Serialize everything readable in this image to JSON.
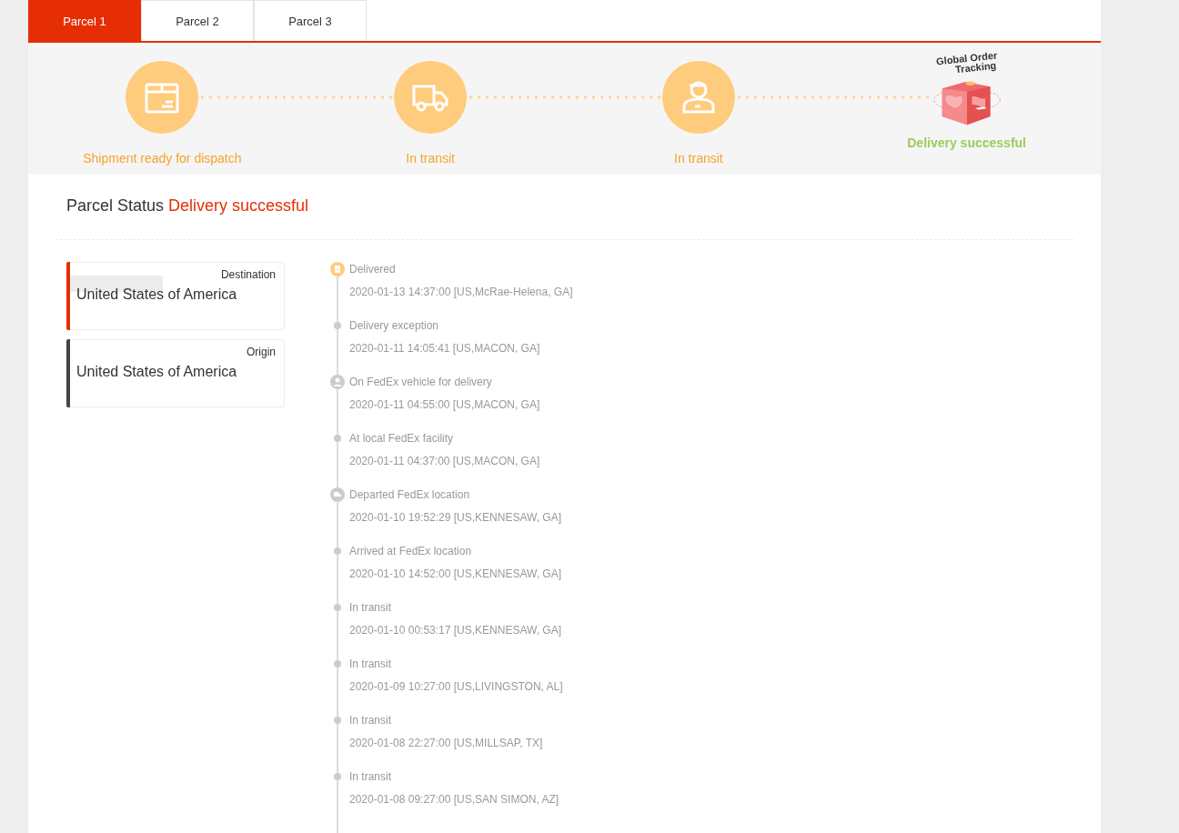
{
  "tabs": [
    {
      "label": "Parcel 1",
      "selected": true
    },
    {
      "label": "Parcel 2",
      "selected": false
    },
    {
      "label": "Parcel 3",
      "selected": false
    }
  ],
  "progress": [
    {
      "kind": "box",
      "label": "Shipment ready for dispatch",
      "final": false
    },
    {
      "kind": "truck",
      "label": "In transit",
      "final": false
    },
    {
      "kind": "courier",
      "label": "In transit",
      "final": false
    },
    {
      "kind": "logo",
      "label": "Delivery successful",
      "final": true,
      "logo_lines": [
        "Global Order",
        "Tracking"
      ]
    }
  ],
  "parcel_status": {
    "label": "Parcel Status",
    "value": "Delivery successful"
  },
  "places": [
    {
      "role": "Destination",
      "country": "United States of America",
      "color": "#e62e04",
      "redacted": true
    },
    {
      "role": "Origin",
      "country": "United States of America",
      "color": "#444444",
      "redacted": false
    }
  ],
  "events": [
    {
      "kind": "delivered",
      "title": "Delivered",
      "detail": "2020-01-13 14:37:00 [US,McRae-Helena, GA]"
    },
    {
      "kind": "dot",
      "title": "Delivery exception",
      "detail": "2020-01-11 14:05:41 [US,MACON, GA]"
    },
    {
      "kind": "courier",
      "title": "On FedEx vehicle for delivery",
      "detail": "2020-01-11 04:55:00 [US,MACON, GA]"
    },
    {
      "kind": "dot",
      "title": "At local FedEx facility",
      "detail": "2020-01-11 04:37:00 [US,MACON, GA]"
    },
    {
      "kind": "truck",
      "title": "Departed FedEx location",
      "detail": "2020-01-10 19:52:29 [US,KENNESAW, GA]"
    },
    {
      "kind": "dot",
      "title": "Arrived at FedEx location",
      "detail": "2020-01-10 14:52:00 [US,KENNESAW, GA]"
    },
    {
      "kind": "dot",
      "title": "In transit",
      "detail": "2020-01-10 00:53:17 [US,KENNESAW, GA]"
    },
    {
      "kind": "dot",
      "title": "In transit",
      "detail": "2020-01-09 10:27:00 [US,LIVINGSTON, AL]"
    },
    {
      "kind": "dot",
      "title": "In transit",
      "detail": "2020-01-08 22:27:00 [US,MILLSAP, TX]"
    },
    {
      "kind": "dot",
      "title": "In transit",
      "detail": "2020-01-08 09:27:00 [US,SAN SIMON, AZ]"
    }
  ]
}
